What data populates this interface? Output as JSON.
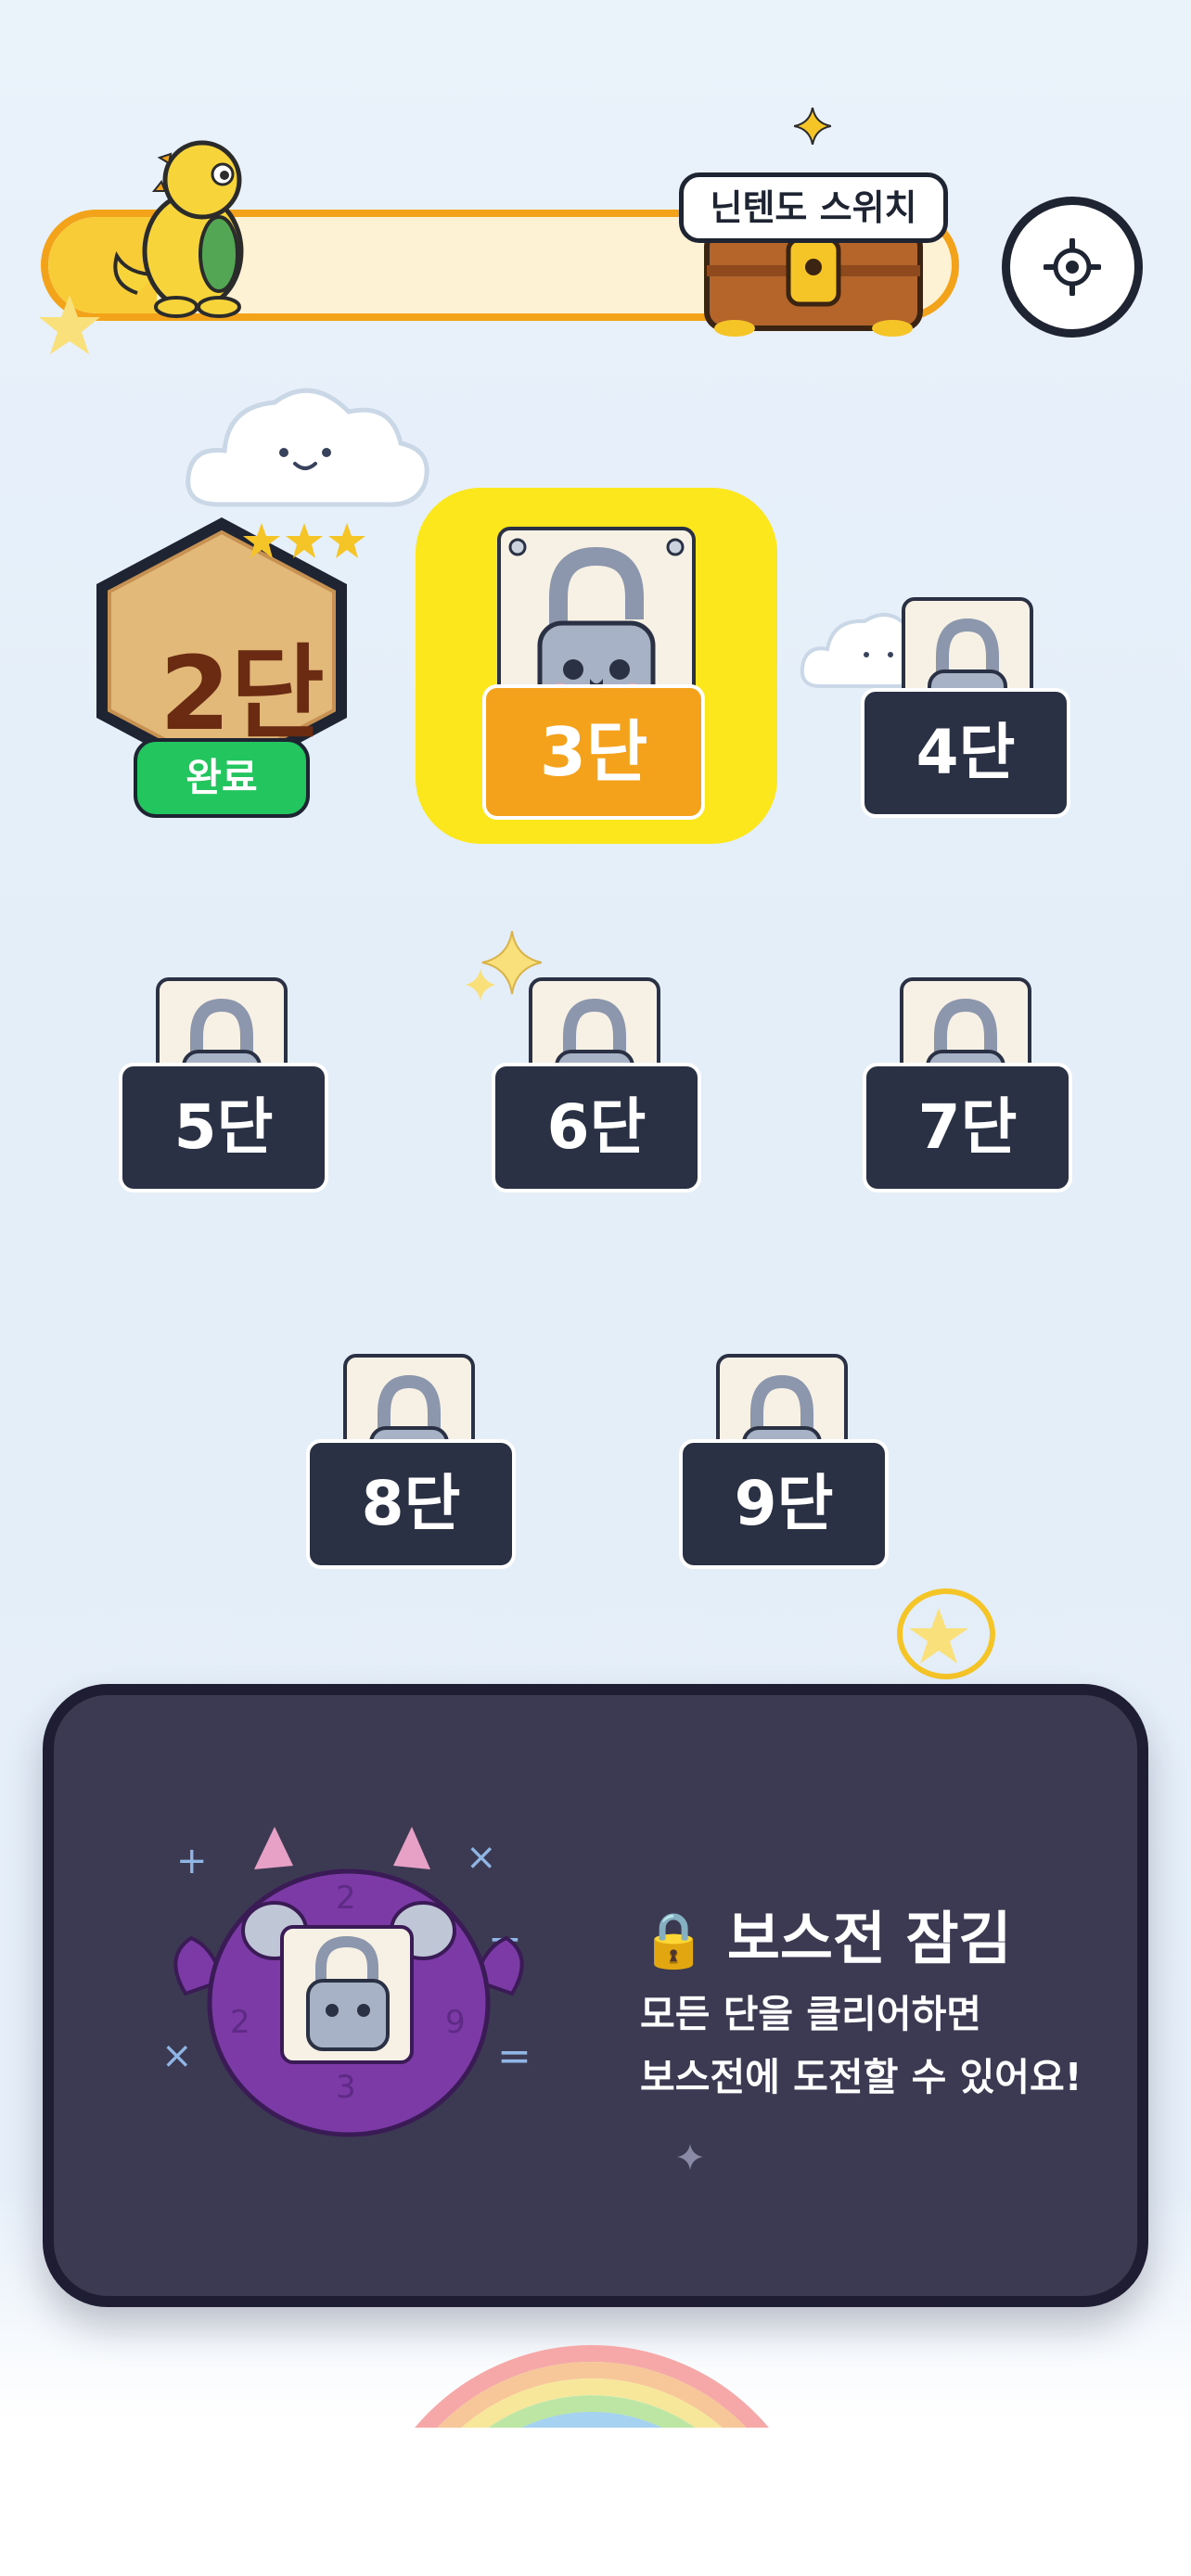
{
  "header": {
    "progress_fraction": 0.12,
    "reward_label": "닌텐도 스위치",
    "settings_icon": "gear-icon"
  },
  "stages": {
    "completed": {
      "label": "2단",
      "badge": "완료",
      "stars": 3
    },
    "current": {
      "label": "3단"
    },
    "locked": [
      "4단",
      "5단",
      "6단",
      "7단",
      "8단",
      "9단"
    ]
  },
  "boss": {
    "title": "보스전 잠김",
    "desc_line1": "모든 단을 클리어하면",
    "desc_line2": "보스전에 도전할 수 있어요!",
    "digits": [
      "2",
      "9",
      "2",
      "3"
    ]
  },
  "colors": {
    "accent_yellow": "#fce61c",
    "accent_orange": "#f4a11c",
    "dark_navy": "#2b3144",
    "done_green": "#22c55e"
  }
}
